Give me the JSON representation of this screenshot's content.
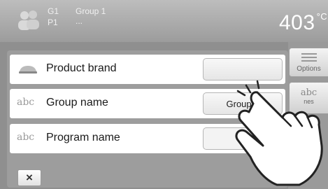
{
  "header": {
    "group_code": "G1",
    "group_name": "Group 1",
    "program_code": "P1",
    "program_name": "...",
    "temperature": "403",
    "temperature_unit": "°C"
  },
  "sidebar": {
    "options_label": "Options",
    "second_icon_text": "abc",
    "second_label_fragment": "nes"
  },
  "dialog": {
    "rows": [
      {
        "icon": "product-brand-icon",
        "label": "Product brand",
        "value": ""
      },
      {
        "icon_text": "abc",
        "label": "Group name",
        "value": "Group 1"
      },
      {
        "icon_text": "abc",
        "label": "Program name",
        "value": "..."
      }
    ],
    "close_label": "×"
  },
  "overlay": {
    "icon": "tapping-hand-icon"
  }
}
